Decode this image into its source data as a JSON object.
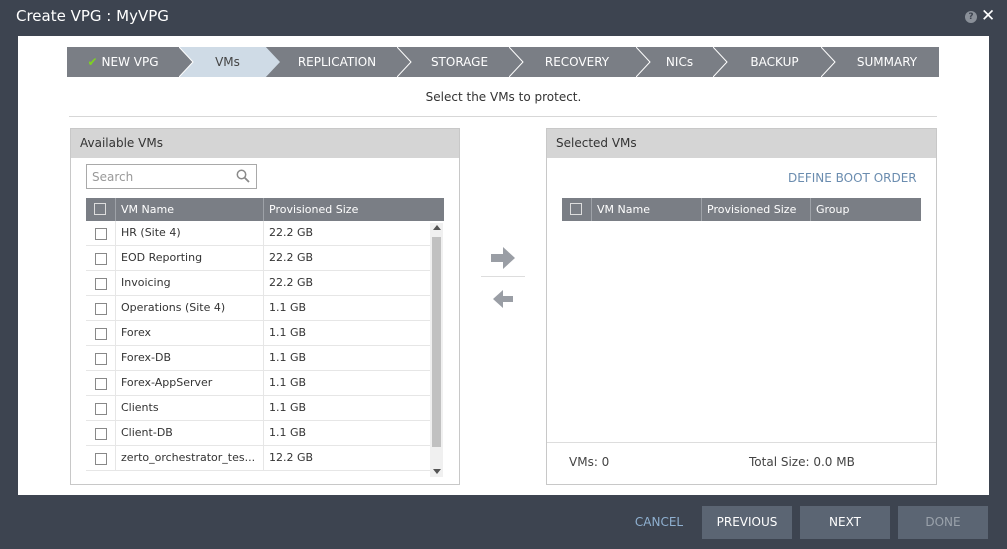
{
  "window": {
    "title": "Create VPG : MyVPG",
    "help_icon": "question-circle-icon",
    "close_icon": "close-icon"
  },
  "wizard": {
    "steps": [
      {
        "label": "NEW VPG",
        "state": "completed"
      },
      {
        "label": "VMs",
        "state": "active"
      },
      {
        "label": "REPLICATION",
        "state": "pending"
      },
      {
        "label": "STORAGE",
        "state": "pending"
      },
      {
        "label": "RECOVERY",
        "state": "pending"
      },
      {
        "label": "NICs",
        "state": "pending"
      },
      {
        "label": "BACKUP",
        "state": "pending"
      },
      {
        "label": "SUMMARY",
        "state": "pending"
      }
    ],
    "check_glyph": "✔",
    "colors": {
      "bar": "#7a7e85",
      "active": "#cfdbe6",
      "check": "#7ed321"
    }
  },
  "instruction": "Select the VMs to protect.",
  "available": {
    "title": "Available VMs",
    "search_placeholder": "Search",
    "columns": [
      "VM Name",
      "Provisioned Size"
    ],
    "rows": [
      {
        "name": "HR (Site 4)",
        "size": "22.2 GB"
      },
      {
        "name": "EOD Reporting",
        "size": "22.2 GB"
      },
      {
        "name": "Invoicing",
        "size": "22.2 GB"
      },
      {
        "name": "Operations (Site 4)",
        "size": "1.1 GB"
      },
      {
        "name": "Forex",
        "size": "1.1 GB"
      },
      {
        "name": "Forex-DB",
        "size": "1.1 GB"
      },
      {
        "name": "Forex-AppServer",
        "size": "1.1 GB"
      },
      {
        "name": "Clients",
        "size": "1.1 GB"
      },
      {
        "name": "Client-DB",
        "size": "1.1 GB"
      },
      {
        "name": "zerto_orchestrator_tes...",
        "size": "12.2 GB"
      }
    ]
  },
  "selected": {
    "title": "Selected VMs",
    "define_boot_order": "DEFINE BOOT ORDER",
    "columns": [
      "VM Name",
      "Provisioned Size",
      "Group"
    ],
    "vms_count": "VMs: 0",
    "total_size": "Total Size: 0.0 MB"
  },
  "buttons": {
    "cancel": "CANCEL",
    "previous": "PREVIOUS",
    "next": "NEXT",
    "done": "DONE"
  }
}
